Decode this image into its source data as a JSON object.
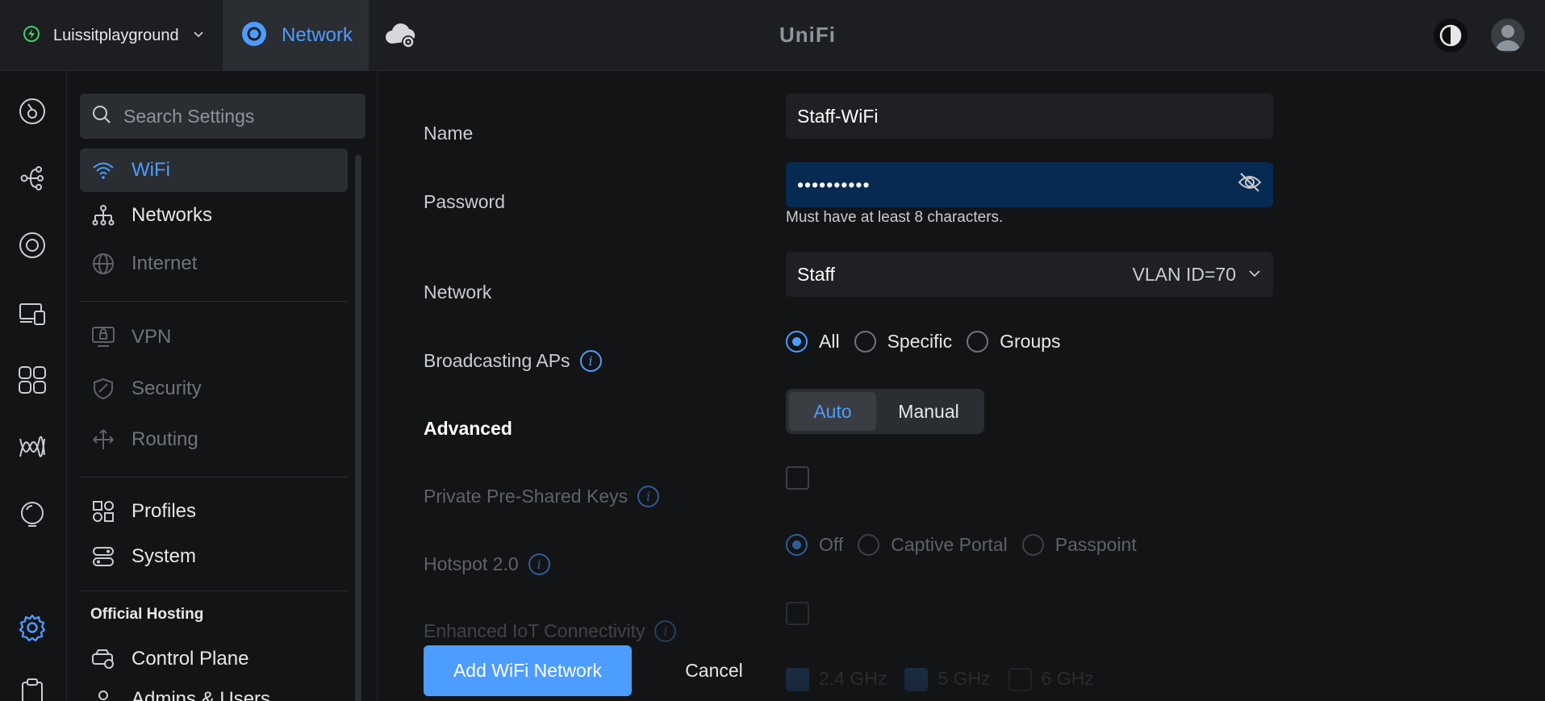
{
  "topbar": {
    "site_name": "Luissitplayground",
    "app_label": "Network",
    "logo": "UniFi"
  },
  "sidebar": {
    "search_placeholder": "Search Settings",
    "items": [
      {
        "label": "WiFi"
      },
      {
        "label": "Networks"
      },
      {
        "label": "Internet"
      },
      {
        "label": "VPN"
      },
      {
        "label": "Security"
      },
      {
        "label": "Routing"
      },
      {
        "label": "Profiles"
      },
      {
        "label": "System"
      }
    ],
    "section_official_hosting": "Official Hosting",
    "hosting_items": [
      {
        "label": "Control Plane"
      },
      {
        "label": "Admins & Users"
      }
    ]
  },
  "form": {
    "name_label": "Name",
    "name_value": "Staff-WiFi",
    "password_label": "Password",
    "password_value": "••••••••••",
    "password_hint": "Must have at least 8 characters.",
    "network_label": "Network",
    "network_value": "Staff",
    "network_vlan": "VLAN ID=70",
    "broadcasting_label": "Broadcasting APs",
    "broadcasting_options": [
      "All",
      "Specific",
      "Groups"
    ],
    "advanced_label": "Advanced",
    "advanced_options": [
      "Auto",
      "Manual"
    ],
    "ppsk_label": "Private Pre-Shared Keys",
    "hotspot_label": "Hotspot 2.0",
    "hotspot_options": [
      "Off",
      "Captive Portal",
      "Passpoint"
    ],
    "iot_label": "Enhanced IoT Connectivity",
    "bands": [
      "2.4 GHz",
      "5 GHz",
      "6 GHz"
    ],
    "add_button": "Add WiFi Network",
    "cancel_button": "Cancel"
  },
  "colors": {
    "accent": "#4d9cff",
    "background": "#131416",
    "topbar": "#1c1e21",
    "focused_field": "#062a52"
  }
}
